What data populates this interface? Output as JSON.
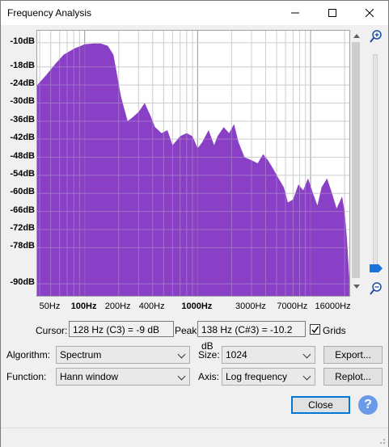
{
  "window": {
    "title": "Frequency Analysis"
  },
  "titlebar_icons": {
    "minimize": "minimize-icon",
    "maximize": "maximize-icon",
    "close": "close-icon"
  },
  "chart_data": {
    "type": "area",
    "xscale": "log",
    "xlim": [
      38,
      22050
    ],
    "ylim": [
      -94,
      -6
    ],
    "grid": true,
    "color": "#8a3fc7",
    "y_ticks": [
      "-10dB",
      "-18dB",
      "-24dB",
      "-30dB",
      "-36dB",
      "-42dB",
      "-48dB",
      "-54dB",
      "-60dB",
      "-66dB",
      "-72dB",
      "-78dB",
      "-90dB"
    ],
    "y_tick_values": [
      -10,
      -18,
      -24,
      -30,
      -36,
      -42,
      -48,
      -54,
      -60,
      -66,
      -72,
      -78,
      -90
    ],
    "x_ticks": [
      "50Hz",
      "100Hz",
      "200Hz",
      "400Hz",
      "1000Hz",
      "3000Hz",
      "7000Hz",
      "16000Hz"
    ],
    "x_tick_values": [
      50,
      100,
      200,
      400,
      1000,
      3000,
      7000,
      16000
    ],
    "x_ticks_bold": [
      "100Hz",
      "1000Hz"
    ],
    "x": [
      38,
      45,
      55,
      65,
      80,
      100,
      120,
      138,
      160,
      180,
      210,
      240,
      260,
      300,
      340,
      380,
      420,
      480,
      540,
      600,
      700,
      800,
      900,
      1000,
      1100,
      1250,
      1400,
      1500,
      1700,
      1900,
      2100,
      2300,
      2600,
      3000,
      3400,
      3800,
      4200,
      4700,
      5200,
      5800,
      6300,
      7000,
      7800,
      8600,
      9500,
      10500,
      11500,
      12500,
      14000,
      15500,
      17000,
      19000,
      20000,
      21000,
      22000
    ],
    "values": [
      -24,
      -21,
      -17,
      -14,
      -12,
      -10.5,
      -10.2,
      -10.2,
      -11,
      -14,
      -28,
      -36,
      -35,
      -33,
      -30,
      -34,
      -38,
      -40,
      -39,
      -44,
      -41,
      -40,
      -41,
      -45,
      -43,
      -39,
      -44,
      -41,
      -38,
      -40,
      -37,
      -43,
      -48,
      -49,
      -50,
      -47,
      -49,
      -52,
      -55,
      -58,
      -63,
      -62,
      -57,
      -59,
      -55,
      -60,
      -64,
      -58,
      -55,
      -60,
      -65,
      -61,
      -66,
      -75,
      -88
    ]
  },
  "bottom": {
    "cursor_label": "Cursor:",
    "cursor_value": "128 Hz (C3) = -9 dB",
    "peak_label": "Peak:",
    "peak_value": "138 Hz (C#3) = -10.2 dB",
    "grids_label": "Grids",
    "grids_checked": true,
    "algorithm_label": "Algorithm:",
    "algorithm_value": "Spectrum",
    "size_label": "Size:",
    "size_value": "1024",
    "function_label": "Function:",
    "function_value": "Hann window",
    "axis_label": "Axis:",
    "axis_value": "Log frequency",
    "export_label": "Export...",
    "replot_label": "Replot...",
    "close_label": "Close",
    "help_label": "?"
  }
}
